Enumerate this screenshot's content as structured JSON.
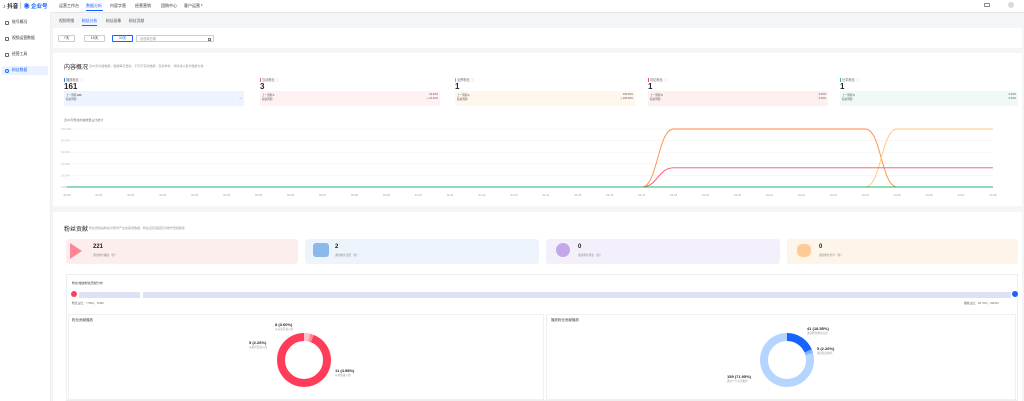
{
  "brand": {
    "app_name": "抖音",
    "partner_name": "企业号",
    "accent": "#1664ff"
  },
  "top_nav": [
    {
      "label": "运营工作台",
      "active": false
    },
    {
      "label": "数据分析",
      "active": true
    },
    {
      "label": "内容字营",
      "active": false
    },
    {
      "label": "经营营销",
      "active": false
    },
    {
      "label": "团购中心",
      "active": false
    },
    {
      "label": "客户运营",
      "active": false
    }
  ],
  "sidebar": [
    {
      "label": "账号概况",
      "active": false
    },
    {
      "label": "视频运营数据",
      "active": false
    },
    {
      "label": "经营工具",
      "active": false
    },
    {
      "label": "粉丝数据",
      "active": true
    }
  ],
  "subtabs": [
    {
      "label": "视频明细",
      "active": false
    },
    {
      "label": "粉丝分析",
      "active": true
    },
    {
      "label": "粉丝画像",
      "active": false
    },
    {
      "label": "粉丝贡献",
      "active": false
    }
  ],
  "filters": {
    "buttons": [
      {
        "label": "7天",
        "active": false
      },
      {
        "label": "15天",
        "active": false
      },
      {
        "label": "30天",
        "active": true
      }
    ],
    "date_placeholder": "请选择日期"
  },
  "content_section": {
    "title": "内容概况",
    "desc": "近30天内容数据，数据每天更新，不同于实时数据，仅供参考，详情请以官方数据为准",
    "metrics": [
      {
        "label": "播放粉丝",
        "value": "161",
        "color": "#3a7bff",
        "bg": "#eef4ff",
        "rows": [
          {
            "k": "上一周期",
            "v": "193"
          },
          {
            "k": "较前周期",
            "v": "—"
          }
        ]
      },
      {
        "label": "互动粉丝",
        "value": "3",
        "color": "#ff5a6e",
        "bg": "#fff0f2",
        "rows": [
          {
            "k": "上一周期",
            "v": "1",
            "p": "33.33%"
          },
          {
            "k": "较前周期",
            "v": "",
            "p": "+ 22.22%"
          }
        ]
      },
      {
        "label": "点赞粉丝",
        "value": "1",
        "color": "#ff9a2e",
        "bg": "#fff6ec",
        "rows": [
          {
            "k": "上一周期",
            "v": "1",
            "p": "100.00%"
          },
          {
            "k": "较前周期",
            "v": "",
            "p": "+ 100.00%"
          }
        ]
      },
      {
        "label": "评论粉丝",
        "value": "1",
        "color": "#ff4d4f",
        "bg": "#fff0f0",
        "rows": [
          {
            "k": "上一周期",
            "v": "0",
            "p": "0.00%"
          },
          {
            "k": "较前周期",
            "v": "",
            "p": "0.00%"
          }
        ]
      },
      {
        "label": "分享粉丝",
        "value": "1",
        "color": "#34c07a",
        "bg": "#eefaf3",
        "rows": [
          {
            "k": "上一周期",
            "v": "0",
            "p": "0.00%"
          },
          {
            "k": "较前周期",
            "v": "",
            "p": "0.00%"
          }
        ]
      }
    ],
    "chart_caption": "近30天粉丝的播放量占比统计"
  },
  "chart_data": {
    "type": "line",
    "x": [
      "03-30",
      "03-31",
      "04-01",
      "04-02",
      "04-03",
      "04-04",
      "04-05",
      "04-06",
      "04-07",
      "04-08",
      "04-09",
      "04-10",
      "04-11",
      "04-12",
      "04-13",
      "04-14",
      "04-15",
      "04-16",
      "04-17",
      "04-18",
      "04-19",
      "04-20",
      "04-21",
      "04-22",
      "04-23",
      "04-24",
      "04-25",
      "04-26",
      "04-27",
      "04-28"
    ],
    "yticks": [
      "100.00%",
      "80.00%",
      "60.00%",
      "40.00%",
      "20.00%",
      "0.00%"
    ],
    "ylim": [
      0,
      100
    ],
    "series": [
      {
        "color": "#ff8a3d",
        "values": [
          0,
          0,
          0,
          0,
          0,
          0,
          0,
          0,
          0,
          0,
          0,
          0,
          0,
          0,
          0,
          0,
          0,
          0,
          0,
          100,
          100,
          100,
          100,
          100,
          100,
          100,
          0,
          0,
          0,
          0
        ]
      },
      {
        "color": "#ffc875",
        "values": [
          0,
          0,
          0,
          0,
          0,
          0,
          0,
          0,
          0,
          0,
          0,
          0,
          0,
          0,
          0,
          0,
          0,
          0,
          0,
          0,
          0,
          0,
          0,
          0,
          0,
          0,
          100,
          100,
          100,
          100
        ]
      },
      {
        "color": "#ff4d6a",
        "values": [
          0,
          0,
          0,
          0,
          0,
          0,
          0,
          0,
          0,
          0,
          0,
          0,
          0,
          0,
          0,
          0,
          0,
          0,
          0,
          33,
          33,
          33,
          33,
          33,
          33,
          33,
          33,
          33,
          33,
          33
        ]
      },
      {
        "color": "#22b573",
        "values": [
          0,
          0,
          0,
          0,
          0,
          0,
          0,
          0,
          0,
          0,
          0,
          0,
          0,
          0,
          0,
          0,
          0,
          0,
          0,
          0,
          0,
          0,
          0,
          0,
          0,
          0,
          0,
          0,
          0,
          0
        ]
      }
    ]
  },
  "fan_section": {
    "title": "粉丝贡献",
    "desc": "粉丝贡献是粉丝对账号产生的各项数据，粉丝活跃度越高对账号贡献越多",
    "cards": [
      {
        "value": "221",
        "label": "通过粉丝播放（次）",
        "bg": "#fdeeee",
        "icon_color": "#ff5a6e"
      },
      {
        "value": "2",
        "label": "通过粉丝点赞（次）",
        "bg": "#eef4fc",
        "icon_color": "#4a90e2"
      },
      {
        "value": "0",
        "label": "通过粉丝评论（次）",
        "bg": "#f3f0fb",
        "icon_color": "#9b6ee0"
      },
      {
        "value": "0",
        "label": "通过粉丝分享（次）",
        "bg": "#fdf4ea",
        "icon_color": "#ff9a2e"
      }
    ],
    "bar_title": "粉丝/播放粉丝贡献分布",
    "bar_left": "粉丝占比：7.56%，15/60",
    "bar_right": "播放占比：92.76%，89/321",
    "donuts": [
      {
        "title": "粉丝贡献播放",
        "segments": [
          {
            "value": "8 (3.60%)",
            "label": "从关注页进入的",
            "color": "#ffc1c7",
            "pct": 3.6
          },
          {
            "value": "5 (2.26%)",
            "label": "从推荐页进入的",
            "color": "#ff8a98",
            "pct": 2.26
          },
          {
            "value": "11 (4.98%)",
            "label": "从搜索进入的",
            "color": "#ff3d5a",
            "pct": 94.14
          }
        ]
      },
      {
        "title": "播放粉丝贡献播放",
        "segments": [
          {
            "value": "41 (18.55%)",
            "label": "通过粉丝推荐关注",
            "color": "#1664ff",
            "pct": 18.55
          },
          {
            "value": "5 (2.26%)",
            "label": "通过私信推荐",
            "color": "#7fb3ff",
            "pct": 2.26
          },
          {
            "value": "159 (71.95%)",
            "label": "通过个人主页推荐",
            "color": "#b5d5ff",
            "pct": 79.19
          }
        ]
      }
    ]
  }
}
